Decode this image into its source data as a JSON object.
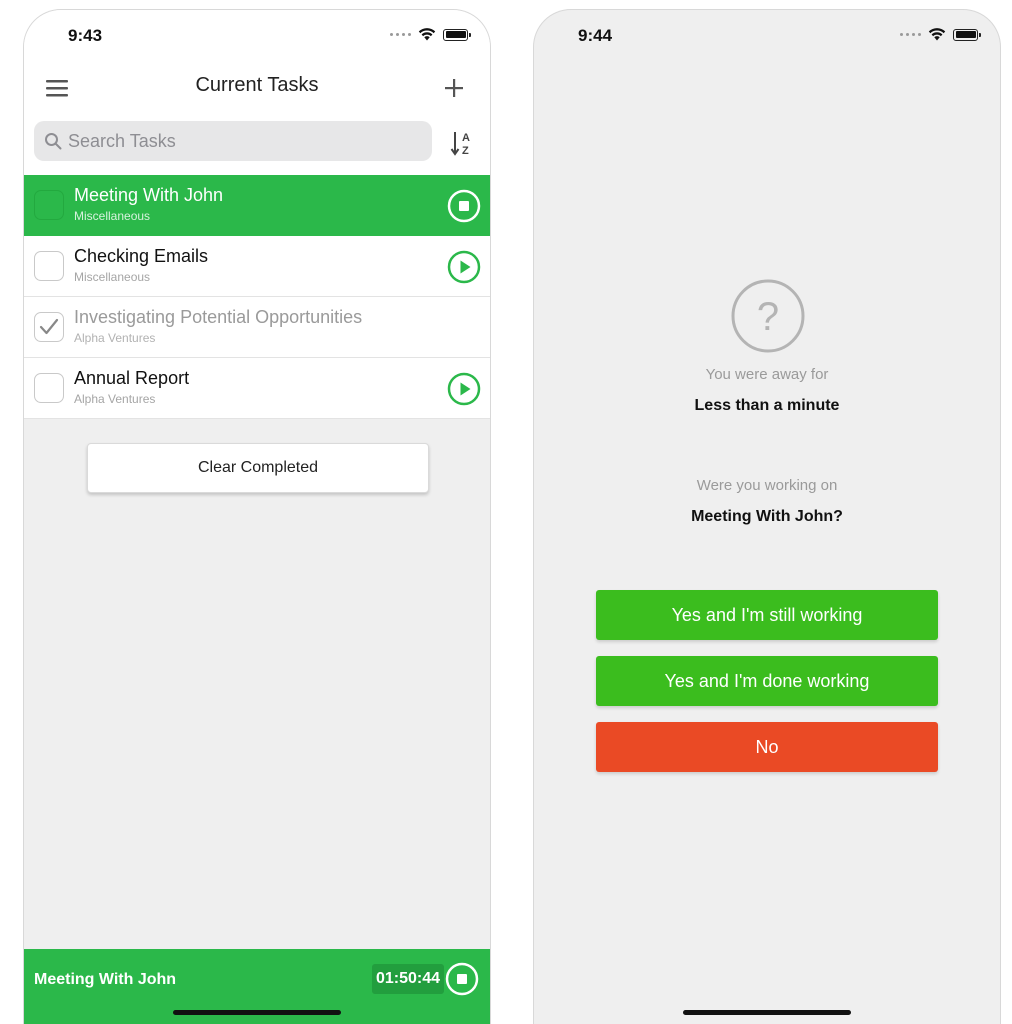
{
  "left_screen": {
    "status_time": "9:43",
    "nav": {
      "title": "Current Tasks"
    },
    "search": {
      "placeholder": "Search Tasks"
    },
    "tasks": [
      {
        "title": "Meeting With John",
        "category": "Miscellaneous",
        "state": "active",
        "action": "stop"
      },
      {
        "title": "Checking Emails",
        "category": "Miscellaneous",
        "state": "idle",
        "action": "play"
      },
      {
        "title": "Investigating Potential Opportunities",
        "category": "Alpha Ventures",
        "state": "completed",
        "action": "none"
      },
      {
        "title": "Annual Report",
        "category": "Alpha Ventures",
        "state": "idle",
        "action": "play"
      }
    ],
    "clear_label": "Clear Completed",
    "timer": {
      "task": "Meeting With John",
      "elapsed": "01:50:44"
    }
  },
  "right_screen": {
    "status_time": "9:44",
    "away_label": "You were away for",
    "away_value": "Less than a minute",
    "working_label": "Were you working on",
    "working_value": "Meeting With John?",
    "buttons": {
      "yes_working": "Yes and I'm still working",
      "yes_done": "Yes and I'm done working",
      "no": "No"
    }
  },
  "colors": {
    "active_green": "#2bb84a",
    "button_green": "#3bbd1e",
    "button_red": "#ea4a25",
    "background": "#efefef"
  },
  "icons": [
    "menu-icon",
    "plus-icon",
    "search-icon",
    "sort-az-icon",
    "stop-icon",
    "play-icon",
    "checkmark-icon",
    "question-icon",
    "wifi-icon",
    "battery-icon"
  ]
}
